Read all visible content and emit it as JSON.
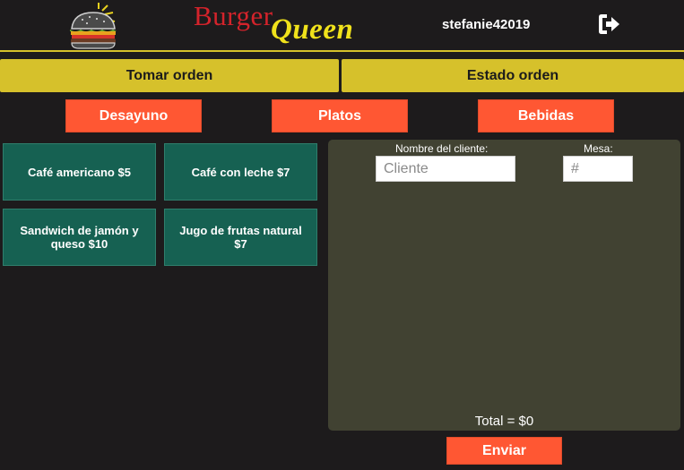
{
  "header": {
    "brand_word_1": "Burger",
    "brand_word_2": "Queen",
    "username": "stefanie42019",
    "logo_icon": "burger-icon",
    "logout_icon": "sign-out-icon"
  },
  "tabs": {
    "take_order": "Tomar orden",
    "order_status": "Estado orden"
  },
  "categories": [
    {
      "label": "Desayuno"
    },
    {
      "label": "Platos"
    },
    {
      "label": "Bebidas"
    }
  ],
  "products": [
    {
      "label": "Café americano $5"
    },
    {
      "label": "Café con leche $7"
    },
    {
      "label": "Sandwich de jamón y queso $10"
    },
    {
      "label": "Jugo de frutas natural $7"
    }
  ],
  "order": {
    "client_label": "Nombre del cliente:",
    "client_placeholder": "Cliente",
    "client_value": "",
    "table_label": "Mesa:",
    "table_placeholder": "#",
    "table_value": "",
    "total": "Total = $0"
  },
  "send_label": "Enviar",
  "colors": {
    "background": "#1d1b1c",
    "accent_yellow": "#d6c12b",
    "button_orange": "#ff5733",
    "product_green": "#166152",
    "panel_olive": "#414232",
    "brand_red": "#d4232b",
    "brand_yellow": "#f0e21b"
  }
}
